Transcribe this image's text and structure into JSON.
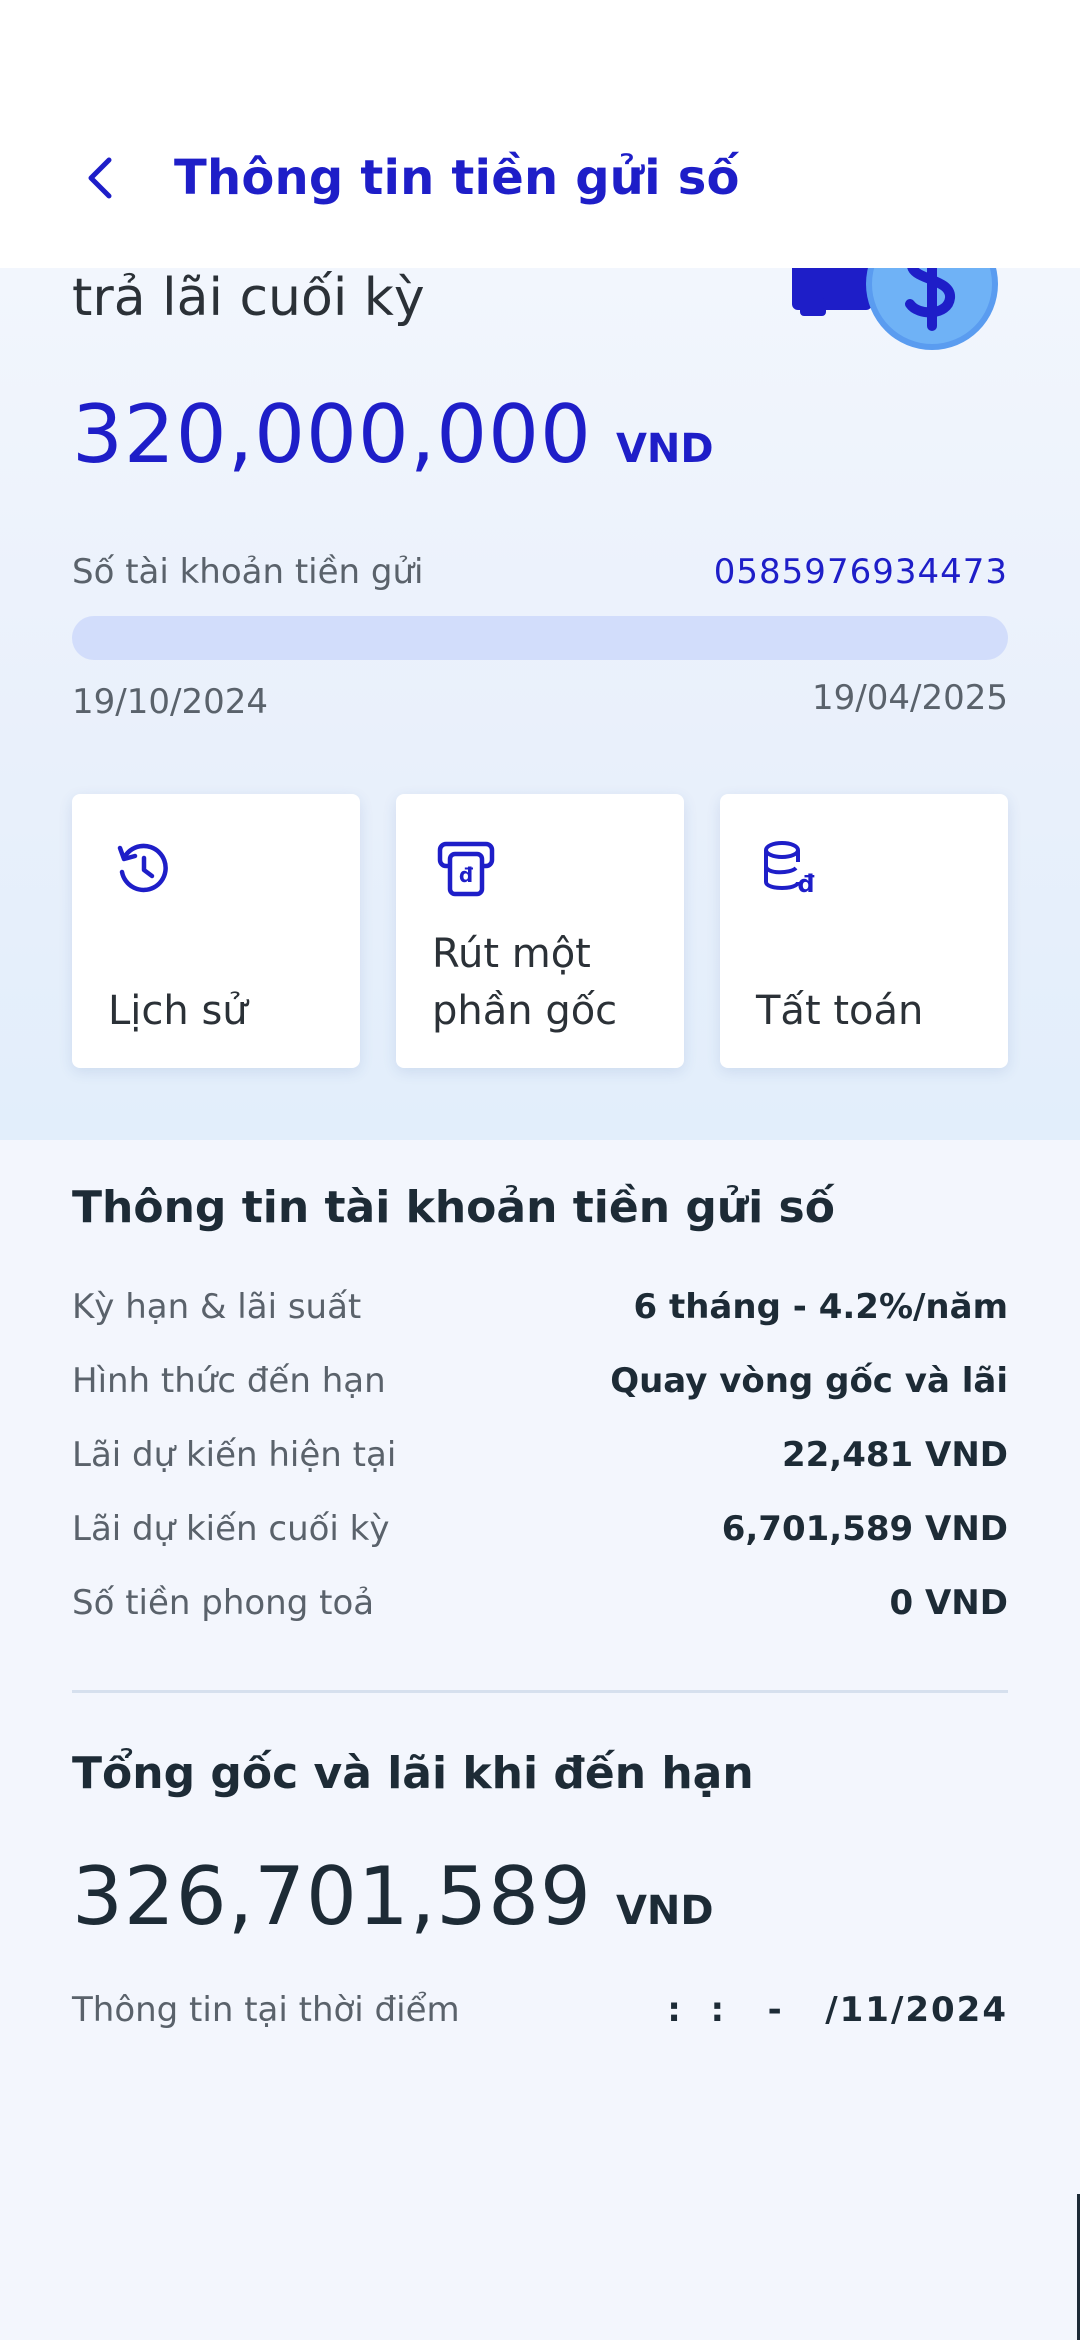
{
  "header": {
    "title": "Thông tin tiền gửi số",
    "back_icon": "chevron-left-icon"
  },
  "colors": {
    "brand": "#1e1ec8",
    "text_dark": "#1d2b36",
    "text_muted": "#5a626b",
    "progress_track": "#d2ddfb"
  },
  "hero": {
    "product_name": "trả lãi cuối kỳ",
    "amount": "320,000,000",
    "currency": "VND",
    "account_label": "Số tài khoản tiền gửi",
    "account_number": "0585976934473",
    "progress_fraction": 0.0,
    "start_date": "19/10/2024",
    "end_date": "19/04/2025",
    "deco_icon": "dollar-coin-icon"
  },
  "actions": [
    {
      "label": "Lịch sử",
      "icon": "history-icon"
    },
    {
      "label": "Rút một phần gốc",
      "icon": "atm-withdraw-icon"
    },
    {
      "label": "Tất toán",
      "icon": "database-dong-icon"
    }
  ],
  "info": {
    "title": "Thông tin tài khoản tiền gửi số",
    "rows": [
      {
        "label": "Kỳ hạn & lãi suất",
        "value": "6 tháng - 4.2%/năm"
      },
      {
        "label": "Hình thức đến hạn",
        "value": "Quay vòng gốc và lãi"
      },
      {
        "label": "Lãi dự kiến hiện tại",
        "value": "22,481 VND"
      },
      {
        "label": "Lãi dự kiến cuối kỳ",
        "value": "6,701,589 VND"
      },
      {
        "label": "Số tiền phong toả",
        "value": "0 VND"
      }
    ]
  },
  "total": {
    "title": "Tổng gốc và lãi khi đến hạn",
    "amount": "326,701,589",
    "currency": "VND",
    "snapshot_label": "Thông tin tại thời điểm",
    "snapshot_time": ":  :   -   /11/2024"
  }
}
